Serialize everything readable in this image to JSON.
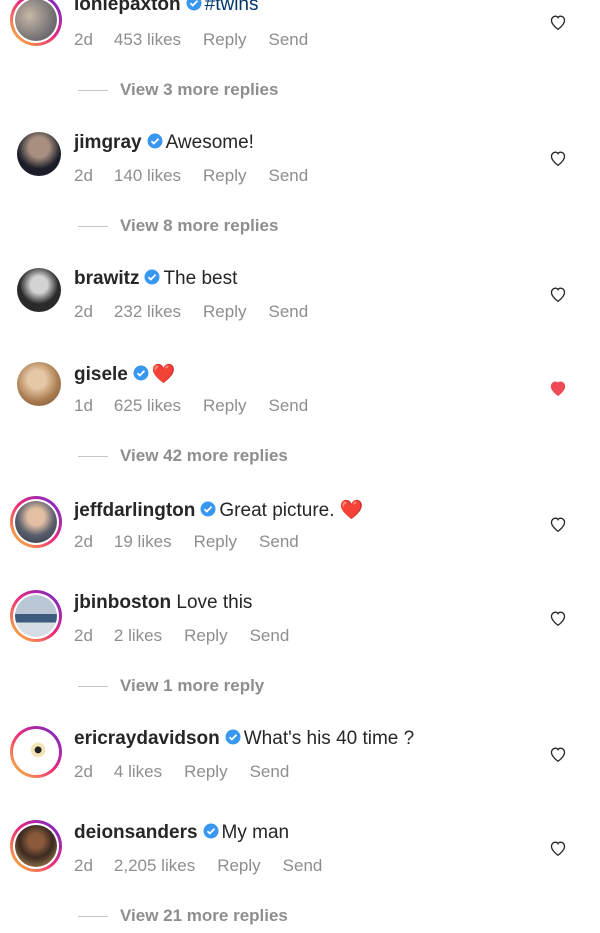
{
  "comments": [
    {
      "username": "loniepaxton",
      "verified": true,
      "text": "#twins",
      "age": "2d",
      "likes": "453 likes",
      "reply": "Reply",
      "send": "Send",
      "liked": false,
      "more_replies": "View 3 more replies"
    },
    {
      "username": "jimgray",
      "verified": true,
      "text": "Awesome!",
      "age": "2d",
      "likes": "140 likes",
      "reply": "Reply",
      "send": "Send",
      "liked": false,
      "more_replies": "View 8 more replies"
    },
    {
      "username": "brawitz",
      "verified": true,
      "text": "The best",
      "age": "2d",
      "likes": "232 likes",
      "reply": "Reply",
      "send": "Send",
      "liked": false
    },
    {
      "username": "gisele",
      "verified": true,
      "text": "❤️",
      "age": "1d",
      "likes": "625 likes",
      "reply": "Reply",
      "send": "Send",
      "liked": true,
      "more_replies": "View 42 more replies"
    },
    {
      "username": "jeffdarlington",
      "verified": true,
      "text": "Great picture. ❤️",
      "age": "2d",
      "likes": "19 likes",
      "reply": "Reply",
      "send": "Send",
      "liked": false
    },
    {
      "username": "jbinboston",
      "verified": false,
      "text": "Love this",
      "age": "2d",
      "likes": "2 likes",
      "reply": "Reply",
      "send": "Send",
      "liked": false,
      "more_replies": "View 1 more reply"
    },
    {
      "username": "ericraydavidson",
      "verified": true,
      "text": "What's his 40 time ?",
      "age": "2d",
      "likes": "4 likes",
      "reply": "Reply",
      "send": "Send",
      "liked": false
    },
    {
      "username": "deionsanders",
      "verified": true,
      "text": "My man",
      "age": "2d",
      "likes": "2,205 likes",
      "reply": "Reply",
      "send": "Send",
      "liked": false,
      "more_replies": "View 21 more replies"
    }
  ],
  "colors": {
    "liked_heart": "#ed4956",
    "verified_badge": "#3897f0",
    "meta_text": "#8e8e8e"
  }
}
